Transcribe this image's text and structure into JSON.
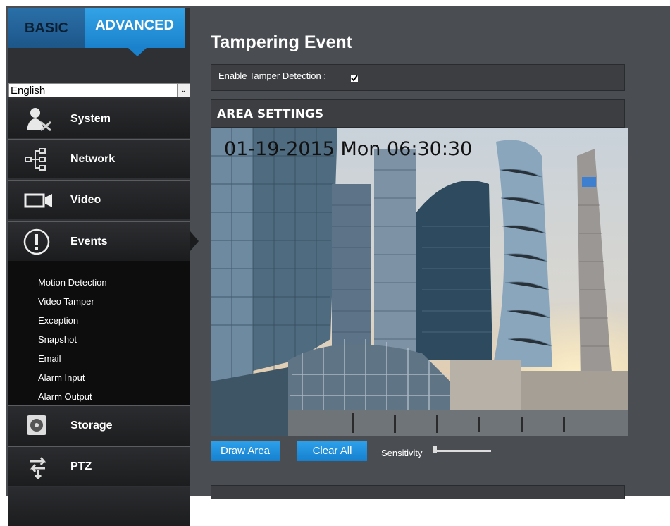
{
  "tabs": {
    "basic": "BASIC",
    "advanced": "ADVANCED"
  },
  "language": {
    "selected": "English"
  },
  "nav": {
    "system": "System",
    "network": "Network",
    "video": "Video",
    "events": "Events",
    "storage": "Storage",
    "ptz": "PTZ"
  },
  "events_submenu": [
    "Motion Detection",
    "Video Tamper",
    "Exception",
    "Snapshot",
    "Email",
    "Alarm Input",
    "Alarm Output"
  ],
  "main": {
    "title": "Tampering Event",
    "enable_label": "Enable Tamper Detection :",
    "enable_checked": true,
    "area_title": "AREA SETTINGS",
    "timestamp": "01-19-2015  Mon 06:30:30",
    "draw_area": "Draw Area",
    "clear_all": "Clear All",
    "sensitivity_label": "Sensitivity",
    "sensitivity_level": 0
  },
  "colors": {
    "accent": "#1a82cc",
    "panel": "#3c3e42",
    "sidebar": "#2f3033"
  }
}
